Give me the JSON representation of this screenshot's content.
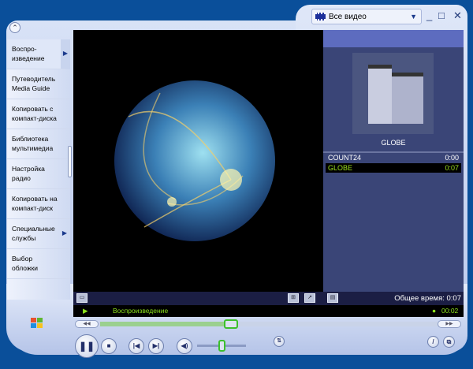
{
  "window": {
    "playlist_selector": "Все видео",
    "minimize": "_",
    "maximize": "□",
    "close": "✕"
  },
  "nav": [
    {
      "label": "Воспро-\nизведение",
      "arrow": true,
      "active": true
    },
    {
      "label": "Путеводитель\nMedia Guide"
    },
    {
      "label": "Копировать с\nкомпакт-диска"
    },
    {
      "label": "Библиотека\nмультимедиа"
    },
    {
      "label": "Настройка\nрадио"
    },
    {
      "label": "Копировать на\nкомпакт-диск"
    },
    {
      "label": "Специальные\nслужбы",
      "arrow": true
    },
    {
      "label": "Выбор\nобложки"
    }
  ],
  "now_playing": {
    "art_title": "GLOBE"
  },
  "playlist": [
    {
      "title": "COUNT24",
      "time": "0:00"
    },
    {
      "title": "GLOBE",
      "time": "0:07",
      "current": true
    }
  ],
  "total_time": "Общее время: 0:07",
  "status": {
    "text": "Воспроизведение",
    "elapsed": "00:02"
  },
  "seek": {
    "progress": 0.38
  },
  "volume": {
    "level": 0.5
  },
  "colors": {
    "accent_green": "#8be01c",
    "background": "#0a4f9a"
  }
}
